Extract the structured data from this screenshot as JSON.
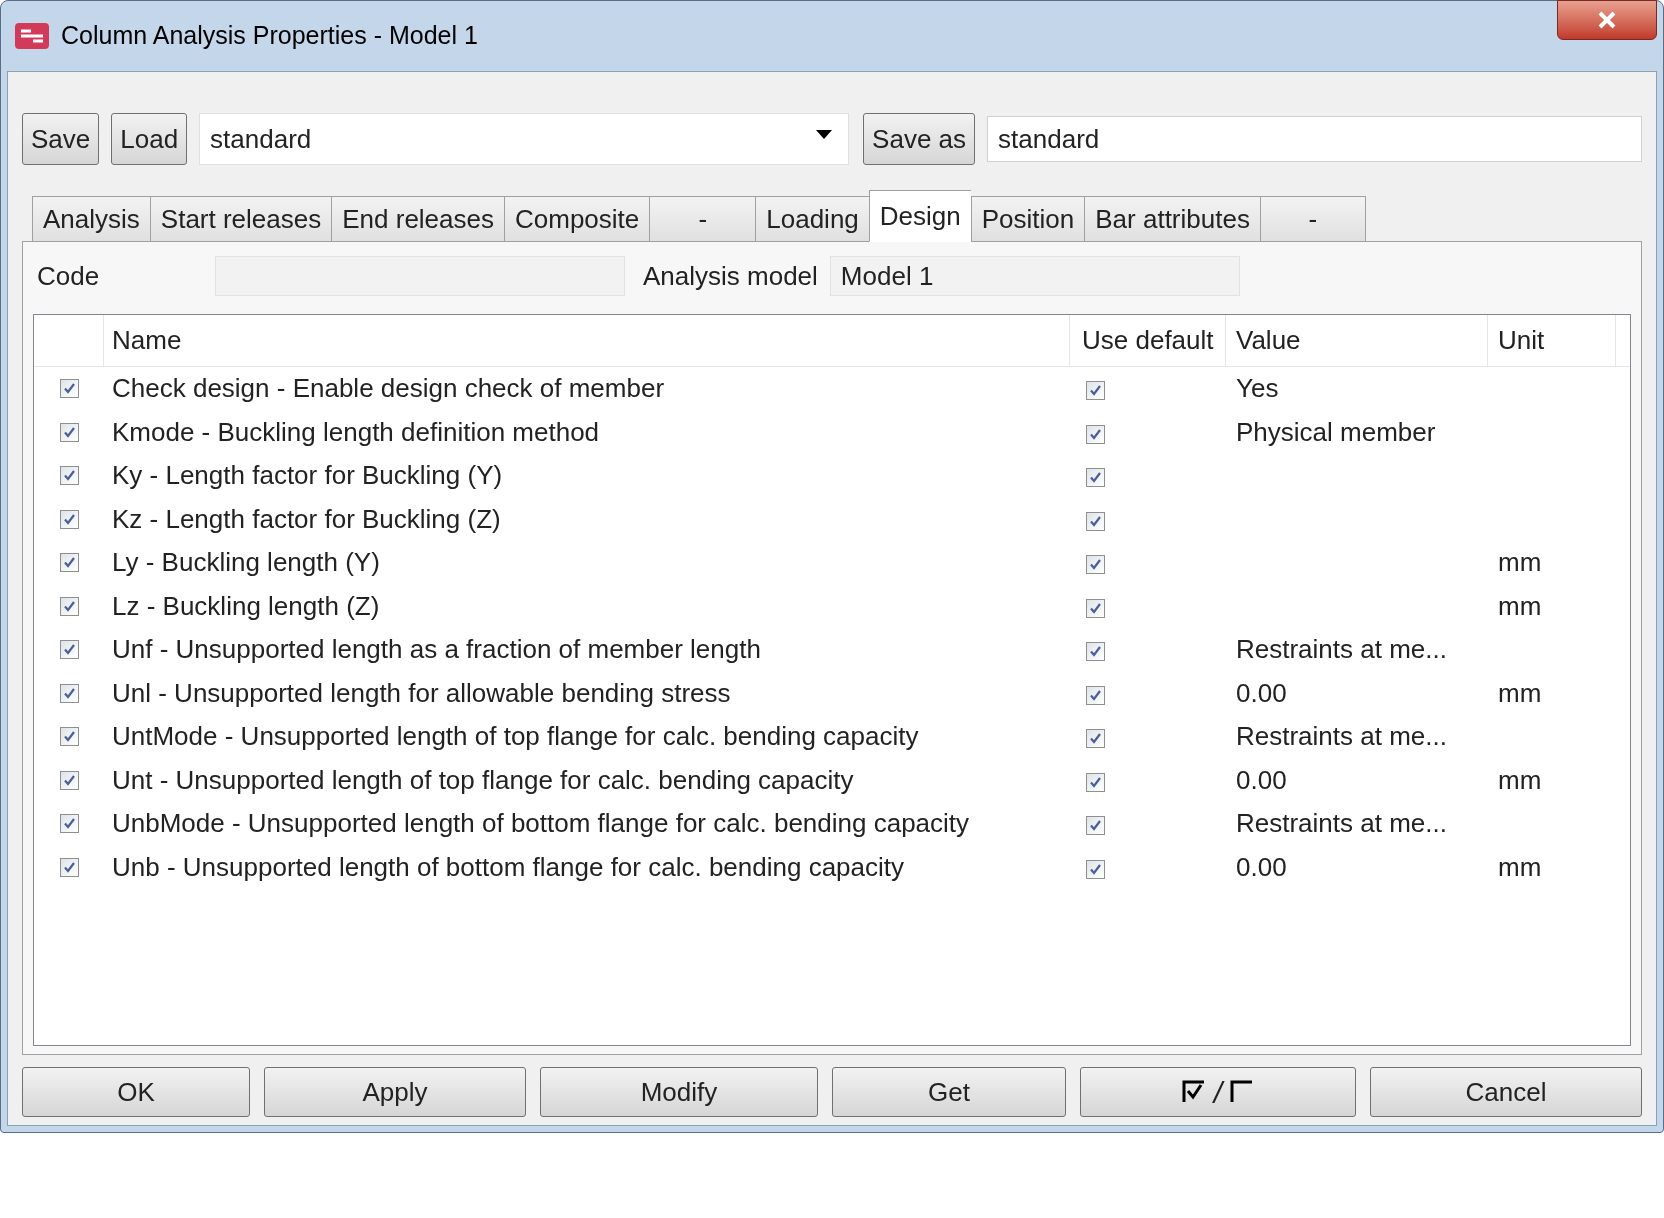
{
  "window": {
    "title": "Column Analysis Properties - Model 1"
  },
  "toolbar": {
    "save": "Save",
    "load": "Load",
    "preset": "standard",
    "save_as": "Save as",
    "save_as_name": "standard"
  },
  "tabs": [
    {
      "label": "Analysis",
      "selected": false
    },
    {
      "label": "Start releases",
      "selected": false
    },
    {
      "label": "End releases",
      "selected": false
    },
    {
      "label": "Composite",
      "selected": false
    },
    {
      "label": "-",
      "selected": false
    },
    {
      "label": "Loading",
      "selected": false
    },
    {
      "label": "Design",
      "selected": true
    },
    {
      "label": "Position",
      "selected": false
    },
    {
      "label": "Bar attributes",
      "selected": false
    },
    {
      "label": "-",
      "selected": false
    }
  ],
  "code": {
    "label": "Code",
    "analysis_model_label": "Analysis model",
    "analysis_model": "Model 1"
  },
  "table": {
    "columns": [
      "Name",
      "Use default",
      "Value",
      "Unit"
    ],
    "rows": [
      {
        "checked": true,
        "name": "Check design - Enable design check of member",
        "use_default": true,
        "value": "Yes"
      },
      {
        "checked": true,
        "name": "Kmode - Buckling length definition method",
        "use_default": true,
        "value": "Physical member"
      },
      {
        "checked": true,
        "name": "Ky - Length factor for Buckling (Y)",
        "use_default": true
      },
      {
        "checked": true,
        "name": "Kz - Length factor for Buckling (Z)",
        "use_default": true
      },
      {
        "checked": true,
        "name": "Ly - Buckling length (Y)",
        "use_default": true,
        "unit": "mm"
      },
      {
        "checked": true,
        "name": "Lz - Buckling length (Z)",
        "use_default": true,
        "unit": "mm"
      },
      {
        "checked": true,
        "name": "Unf - Unsupported length as a fraction of member length",
        "use_default": true,
        "value": "Restraints at me..."
      },
      {
        "checked": true,
        "name": "Unl - Unsupported length for allowable bending stress",
        "use_default": true,
        "value": "0.00",
        "unit": "mm"
      },
      {
        "checked": true,
        "name": "UntMode - Unsupported length of top flange for calc. bending capacity",
        "use_default": true,
        "value": "Restraints at me..."
      },
      {
        "checked": true,
        "name": "Unt - Unsupported length of top flange for calc. bending capacity",
        "use_default": true,
        "value": "0.00",
        "unit": "mm"
      },
      {
        "checked": true,
        "name": "UnbMode - Unsupported length of bottom flange for calc. bending capacity",
        "use_default": true,
        "value": "Restraints at me..."
      },
      {
        "checked": true,
        "name": "Unb - Unsupported length of bottom flange for calc. bending capacity",
        "use_default": true,
        "value": "0.00",
        "unit": "mm"
      }
    ]
  },
  "buttons": {
    "ok": "OK",
    "apply": "Apply",
    "modify": "Modify",
    "get": "Get",
    "toggle_separator": "/",
    "cancel": "Cancel"
  }
}
